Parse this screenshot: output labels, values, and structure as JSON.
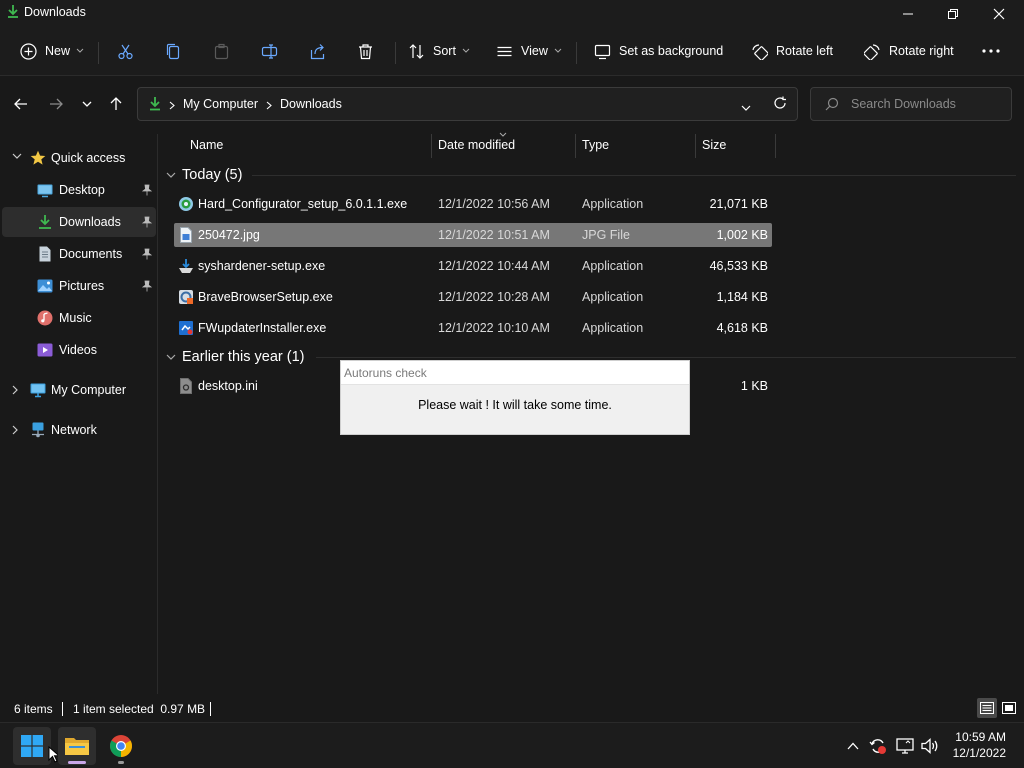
{
  "window": {
    "title": "Downloads"
  },
  "toolbar": {
    "new_label": "New",
    "sort_label": "Sort",
    "view_label": "View",
    "set_background_label": "Set as background",
    "rotate_left_label": "Rotate left",
    "rotate_right_label": "Rotate right"
  },
  "address": {
    "crumbs": [
      "My Computer",
      "Downloads"
    ],
    "search_placeholder": "Search Downloads"
  },
  "sidebar": {
    "quick_access": "Quick access",
    "items": [
      {
        "label": "Desktop",
        "pinned": true
      },
      {
        "label": "Downloads",
        "pinned": true,
        "selected": true
      },
      {
        "label": "Documents",
        "pinned": true
      },
      {
        "label": "Pictures",
        "pinned": true
      },
      {
        "label": "Music",
        "pinned": false
      },
      {
        "label": "Videos",
        "pinned": false
      }
    ],
    "my_computer": "My Computer",
    "network": "Network"
  },
  "columns": [
    "Name",
    "Date modified",
    "Type",
    "Size"
  ],
  "groups": [
    {
      "label": "Today (5)",
      "files": [
        {
          "name": "Hard_Configurator_setup_6.0.1.1.exe",
          "date": "12/1/2022 10:56 AM",
          "type": "Application",
          "size": "21,071 KB"
        },
        {
          "name": "250472.jpg",
          "date": "12/1/2022 10:51 AM",
          "type": "JPG File",
          "size": "1,002 KB",
          "selected": true
        },
        {
          "name": "syshardener-setup.exe",
          "date": "12/1/2022 10:44 AM",
          "type": "Application",
          "size": "46,533 KB"
        },
        {
          "name": "BraveBrowserSetup.exe",
          "date": "12/1/2022 10:28 AM",
          "type": "Application",
          "size": "1,184 KB"
        },
        {
          "name": "FWupdaterInstaller.exe",
          "date": "12/1/2022 10:10 AM",
          "type": "Application",
          "size": "4,618 KB"
        }
      ]
    },
    {
      "label": "Earlier this year (1)",
      "files": [
        {
          "name": "desktop.ini",
          "date": "",
          "type": "",
          "size": "1 KB"
        }
      ]
    }
  ],
  "dialog": {
    "title": "Autoruns check",
    "message": "Please wait !  It will take some time."
  },
  "status": {
    "item_count": "6 items",
    "selection": "1 item selected  0.97 MB"
  },
  "clock": {
    "time": "10:59 AM",
    "date": "12/1/2022"
  },
  "colors": {
    "selected_row": "#777777",
    "background": "#191919",
    "accent_green": "#3fb950",
    "folder_yellow": "#f2c744"
  }
}
